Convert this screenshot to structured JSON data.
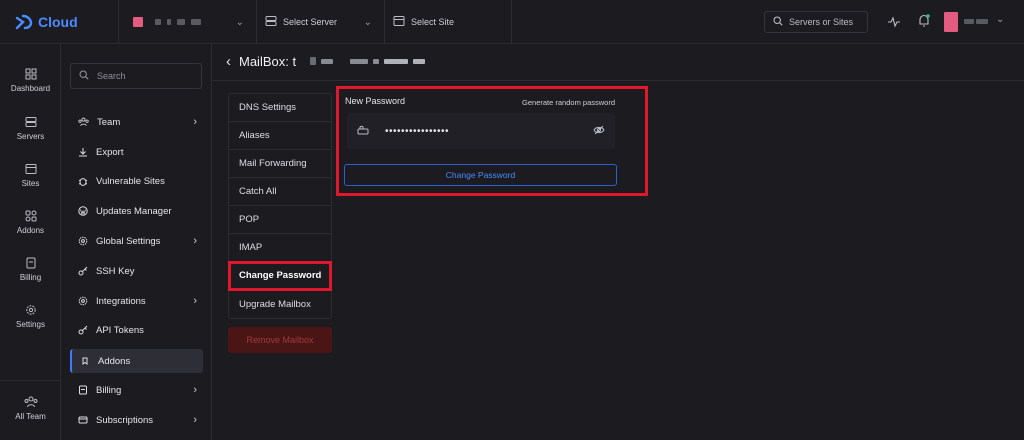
{
  "app": {
    "name": "Cloud",
    "brand_color": "#4a8cff",
    "accent_red": "#e0182d"
  },
  "topbar": {
    "server_select": "Select Server",
    "site_select": "Select Site",
    "search_placeholder": "Servers or Sites"
  },
  "rail": [
    {
      "label": "Dashboard",
      "icon": "dashboard-icon"
    },
    {
      "label": "Servers",
      "icon": "servers-icon"
    },
    {
      "label": "Sites",
      "icon": "sites-icon"
    },
    {
      "label": "Addons",
      "icon": "addons-icon"
    },
    {
      "label": "Billing",
      "icon": "billing-icon"
    },
    {
      "label": "Settings",
      "icon": "settings-icon"
    },
    {
      "label": "All Team",
      "icon": "team-icon"
    }
  ],
  "sidebar": {
    "search_placeholder": "Search",
    "items": [
      {
        "label": "Team",
        "icon": "team-icon",
        "has_arrow": true
      },
      {
        "label": "Export",
        "icon": "export-icon",
        "has_arrow": false
      },
      {
        "label": "Vulnerable Sites",
        "icon": "bug-icon",
        "has_arrow": false
      },
      {
        "label": "Updates Manager",
        "icon": "wordpress-icon",
        "has_arrow": false
      },
      {
        "label": "Global Settings",
        "icon": "gear-icon",
        "has_arrow": true
      },
      {
        "label": "SSH Key",
        "icon": "key-icon",
        "has_arrow": false
      },
      {
        "label": "Integrations",
        "icon": "integrations-icon",
        "has_arrow": true
      },
      {
        "label": "API Tokens",
        "icon": "token-icon",
        "has_arrow": false
      },
      {
        "label": "Addons",
        "icon": "addons-icon",
        "has_arrow": false,
        "active": true
      },
      {
        "label": "Billing",
        "icon": "billing-icon",
        "has_arrow": true
      },
      {
        "label": "Subscriptions",
        "icon": "subscriptions-icon",
        "has_arrow": true
      }
    ]
  },
  "main": {
    "title": "MailBox: t",
    "mail_nav": [
      "DNS Settings",
      "Aliases",
      "Mail Forwarding",
      "Catch All",
      "POP",
      "IMAP",
      "Change Password",
      "Upgrade Mailbox"
    ],
    "active_nav": "Change Password",
    "remove_label": "Remove Mailbox",
    "password": {
      "label": "New Password",
      "generate_link": "Generate random password",
      "value": "••••••••••••••••",
      "submit_label": "Change Password"
    }
  }
}
